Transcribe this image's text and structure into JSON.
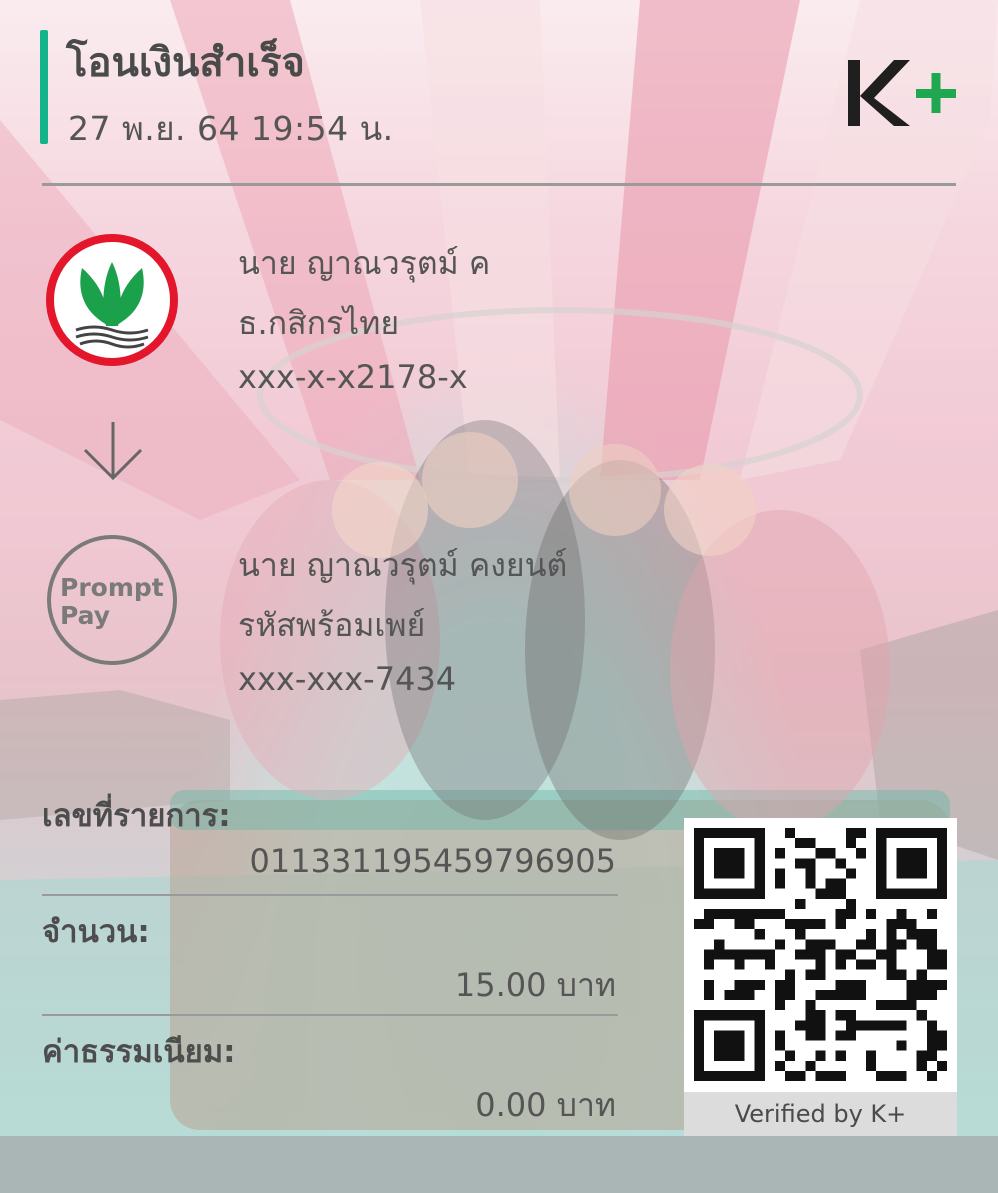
{
  "header": {
    "title": "โอนเงินสำเร็จ",
    "datetime": "27 พ.ย. 64  19:54 น.",
    "brand_logo": "K+"
  },
  "sender": {
    "bank_icon": "kasikorn-bank-logo",
    "name": "นาย ญาณวรุตม์ ค",
    "bank": "ธ.กสิกรไทย",
    "account": "xxx-x-x2178-x"
  },
  "receiver": {
    "logo_text_1": "Prompt",
    "logo_text_2": "Pay",
    "name": "นาย ญาณวรุตม์ คงยนต์",
    "bank": "รหัสพร้อมเพย์",
    "account": "xxx-xxx-7434"
  },
  "details": {
    "ref_label": "เลขที่รายการ:",
    "ref_value": "011331195459796905",
    "amount_label": "จำนวน:",
    "amount_value": "15.00 บาท",
    "fee_label": "ค่าธรรมเนียม:",
    "fee_value": "0.00 บาท"
  },
  "qr": {
    "caption": "Verified by K+"
  },
  "colors": {
    "accent_green": "#14b48a",
    "kbank_green": "#1ba04b",
    "kbank_red": "#e3162b",
    "text_dark": "#4a4a4a"
  }
}
